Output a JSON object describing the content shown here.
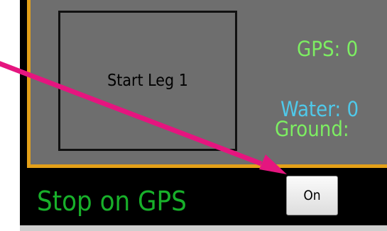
{
  "controls": {
    "start_leg_label": "Start Leg 1",
    "gps_readout": "GPS: 0",
    "water_readout": "Water: 0",
    "ground_readout": "Ground:",
    "stop_on_gps_label": "Stop on GPS",
    "on_button_label": "On"
  },
  "colors": {
    "panel_border": "#e3a019",
    "panel_fill": "#6e6e6e",
    "gps_text": "#7dee62",
    "water_text": "#4fc9ea",
    "stop_label_text": "#18b02a",
    "annotation_arrow": "#e5157f"
  },
  "annotation": {
    "icon": "arrow-icon"
  }
}
